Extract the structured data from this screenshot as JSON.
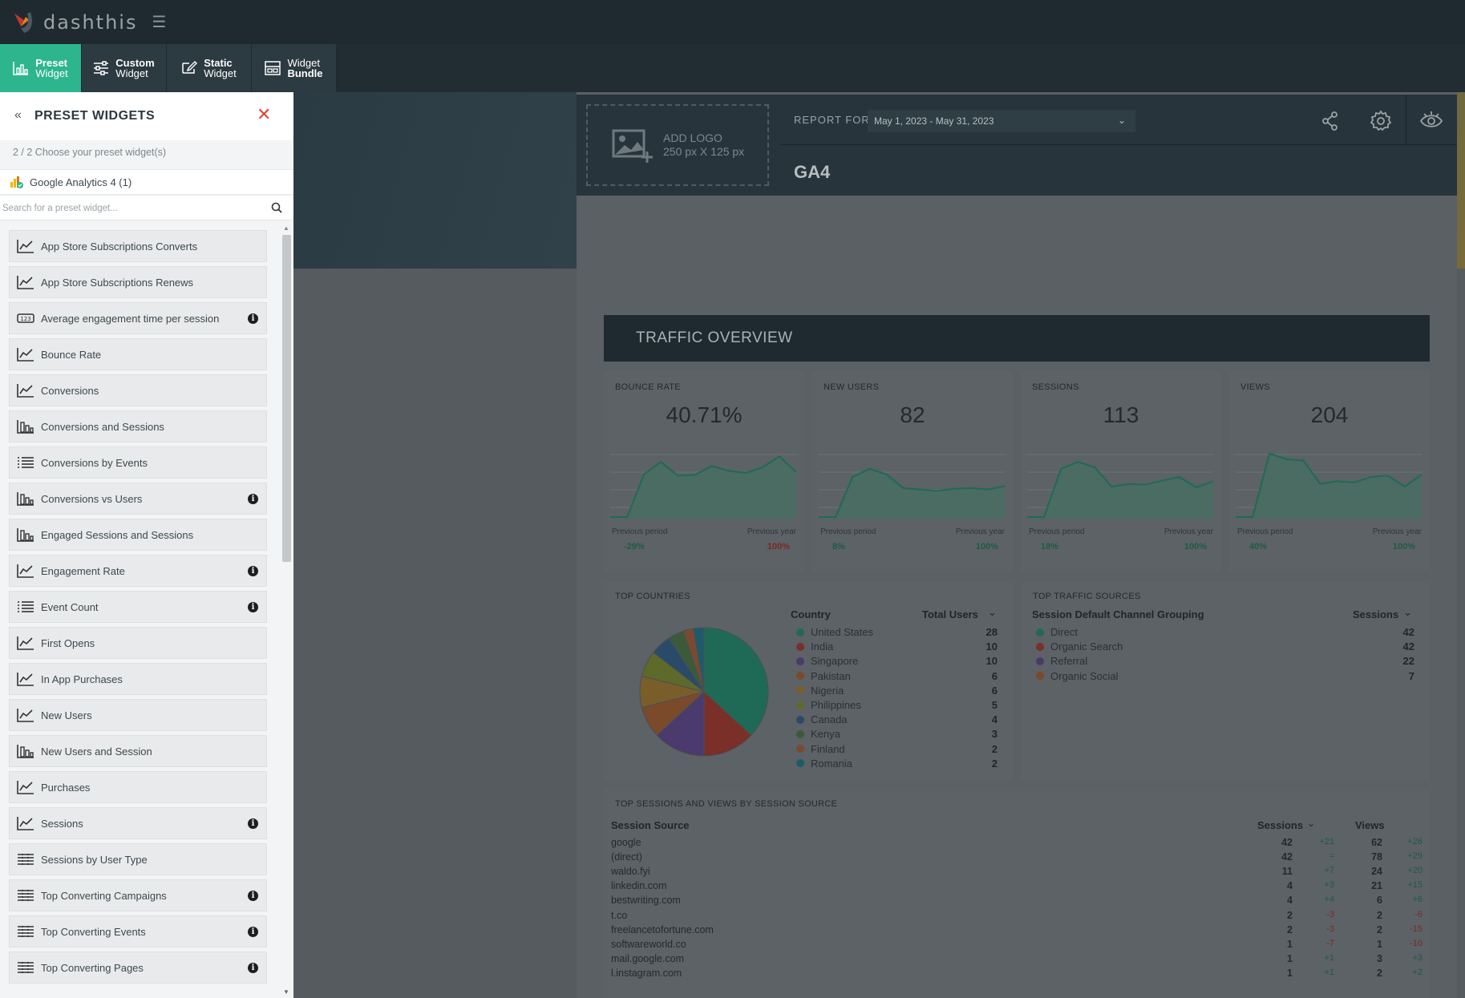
{
  "app": {
    "logo_text": "dashthis"
  },
  "tabs": [
    {
      "line1": "Preset",
      "line2": "Widget",
      "icon": "bar-chart-icon",
      "active": true
    },
    {
      "line1": "Custom",
      "line2": "Widget",
      "icon": "sliders-icon"
    },
    {
      "line1": "Static",
      "line2": "Widget",
      "icon": "edit-icon"
    },
    {
      "line1": "Widget",
      "line2": "Bundle",
      "icon": "bundle-icon"
    }
  ],
  "panel": {
    "title": "PRESET WIDGETS",
    "step": "2 / 2   Choose your preset widget(s)",
    "source": "Google Analytics 4 (1)",
    "search_placeholder": "Search for a preset widget...",
    "items": [
      {
        "label": "App Store Subscriptions Converts",
        "icon": "line-chart-icon",
        "info": false
      },
      {
        "label": "App Store Subscriptions Renews",
        "icon": "line-chart-icon",
        "info": false
      },
      {
        "label": "Average engagement time per session",
        "icon": "number-icon",
        "info": true
      },
      {
        "label": "Bounce Rate",
        "icon": "line-chart-icon",
        "info": false
      },
      {
        "label": "Conversions",
        "icon": "line-chart-icon",
        "info": false
      },
      {
        "label": "Conversions and Sessions",
        "icon": "bar-chart-icon",
        "info": false
      },
      {
        "label": "Conversions by Events",
        "icon": "list-icon",
        "info": false
      },
      {
        "label": "Conversions vs Users",
        "icon": "bar-chart-icon",
        "info": true
      },
      {
        "label": "Engaged Sessions and Sessions",
        "icon": "bar-chart-icon",
        "info": false
      },
      {
        "label": "Engagement Rate",
        "icon": "line-chart-icon",
        "info": true
      },
      {
        "label": "Event Count",
        "icon": "list-icon",
        "info": true
      },
      {
        "label": "First Opens",
        "icon": "line-chart-icon",
        "info": false
      },
      {
        "label": "In App Purchases",
        "icon": "line-chart-icon",
        "info": false
      },
      {
        "label": "New Users",
        "icon": "line-chart-icon",
        "info": false
      },
      {
        "label": "New Users and Session",
        "icon": "bar-chart-icon",
        "info": false
      },
      {
        "label": "Purchases",
        "icon": "line-chart-icon",
        "info": false
      },
      {
        "label": "Sessions",
        "icon": "line-chart-icon",
        "info": true
      },
      {
        "label": "Sessions by User Type",
        "icon": "table-icon",
        "info": false
      },
      {
        "label": "Top Converting Campaigns",
        "icon": "table-icon",
        "info": true
      },
      {
        "label": "Top Converting Events",
        "icon": "table-icon",
        "info": true
      },
      {
        "label": "Top Converting Pages",
        "icon": "table-icon",
        "info": true
      }
    ]
  },
  "report": {
    "add_logo": "ADD LOGO",
    "logo_size": "250 px X 125 px",
    "report_for_label": "REPORT FOR",
    "date_range": "May 1, 2023 - May 31, 2023",
    "title": "GA4",
    "section_title": "TRAFFIC OVERVIEW",
    "kpis": [
      {
        "title": "BOUNCE RATE",
        "value": "40.71%",
        "prev_period_label": "Previous period",
        "prev_year_label": "Previous year",
        "prev_period": "-29%",
        "prev_year": "100%",
        "prev_period_good": true,
        "prev_year_good": false,
        "spark": [
          0,
          0,
          62,
          80,
          60,
          61,
          74,
          67,
          64,
          72,
          88,
          65
        ]
      },
      {
        "title": "NEW USERS",
        "value": "82",
        "prev_period_label": "Previous period",
        "prev_year_label": "Previous year",
        "prev_period": "8%",
        "prev_year": "100%",
        "prev_period_good": true,
        "prev_year_good": true,
        "spark": [
          0,
          0,
          58,
          70,
          62,
          42,
          40,
          38,
          41,
          42,
          40,
          45
        ]
      },
      {
        "title": "SESSIONS",
        "value": "113",
        "prev_period_label": "Previous period",
        "prev_year_label": "Previous year",
        "prev_period": "18%",
        "prev_year": "100%",
        "prev_period_good": true,
        "prev_year_good": true,
        "spark": [
          0,
          0,
          70,
          80,
          72,
          44,
          48,
          47,
          53,
          58,
          43,
          52
        ]
      },
      {
        "title": "VIEWS",
        "value": "204",
        "prev_period_label": "Previous period",
        "prev_year_label": "Previous year",
        "prev_period": "40%",
        "prev_year": "100%",
        "prev_period_good": true,
        "prev_year_good": true,
        "spark": [
          0,
          0,
          92,
          84,
          82,
          48,
          52,
          50,
          58,
          60,
          44,
          62
        ]
      }
    ],
    "countries": {
      "title": "TOP COUNTRIES",
      "col1": "Country",
      "col2": "Total Users",
      "rows": [
        {
          "name": "United States",
          "value": 28,
          "color": "#1f6a56"
        },
        {
          "name": "India",
          "value": 10,
          "color": "#7a2f28"
        },
        {
          "name": "Singapore",
          "value": 10,
          "color": "#4a3a6e"
        },
        {
          "name": "Pakistan",
          "value": 6,
          "color": "#7a4a2a"
        },
        {
          "name": "Nigeria",
          "value": 6,
          "color": "#7a5e2a"
        },
        {
          "name": "Philippines",
          "value": 5,
          "color": "#5e6a2a"
        },
        {
          "name": "Canada",
          "value": 4,
          "color": "#2a4a6a"
        },
        {
          "name": "Kenya",
          "value": 3,
          "color": "#3a5a3a"
        },
        {
          "name": "Finland",
          "value": 2,
          "color": "#7a4a30"
        },
        {
          "name": "Romania",
          "value": 2,
          "color": "#1f5a6a"
        }
      ]
    },
    "traffic_sources": {
      "title": "TOP TRAFFIC SOURCES",
      "col1": "Session Default Channel Grouping",
      "col2": "Sessions",
      "rows": [
        {
          "name": "Direct",
          "value": 42,
          "color": "#1f6a56"
        },
        {
          "name": "Organic Search",
          "value": 42,
          "color": "#7a2f28"
        },
        {
          "name": "Referral",
          "value": 22,
          "color": "#4a3a6e"
        },
        {
          "name": "Organic Social",
          "value": 7,
          "color": "#7a4a2a"
        }
      ]
    },
    "sources_table": {
      "title": "TOP SESSIONS AND VIEWS BY SESSION SOURCE",
      "col1": "Session Source",
      "col2": "Sessions",
      "col3": "Views",
      "rows": [
        {
          "source": "google",
          "sessions": "42",
          "s_delta": "+21",
          "views": "62",
          "v_delta": "+26"
        },
        {
          "source": "(direct)",
          "sessions": "42",
          "s_delta": "=",
          "views": "78",
          "v_delta": "+29"
        },
        {
          "source": "waldo.fyi",
          "sessions": "11",
          "s_delta": "+7",
          "views": "24",
          "v_delta": "+20"
        },
        {
          "source": "linkedin.com",
          "sessions": "4",
          "s_delta": "+3",
          "views": "21",
          "v_delta": "+15"
        },
        {
          "source": "bestwriting.com",
          "sessions": "4",
          "s_delta": "+4",
          "views": "6",
          "v_delta": "+6"
        },
        {
          "source": "t.co",
          "sessions": "2",
          "s_delta": "-3",
          "views": "2",
          "v_delta": "-6"
        },
        {
          "source": "freelancetofortune.com",
          "sessions": "2",
          "s_delta": "-3",
          "views": "2",
          "v_delta": "-15"
        },
        {
          "source": "softwareworld.co",
          "sessions": "1",
          "s_delta": "-7",
          "views": "1",
          "v_delta": "-10"
        },
        {
          "source": "mail.google.com",
          "sessions": "1",
          "s_delta": "+1",
          "views": "3",
          "v_delta": "+3"
        },
        {
          "source": "l.instagram.com",
          "sessions": "1",
          "s_delta": "+1",
          "views": "2",
          "v_delta": "+2"
        }
      ]
    }
  },
  "colors": {
    "accent": "#2db58e",
    "close": "#e0473a",
    "spark_line": "#1f6a56",
    "spark_fill": "#4a6c63"
  }
}
